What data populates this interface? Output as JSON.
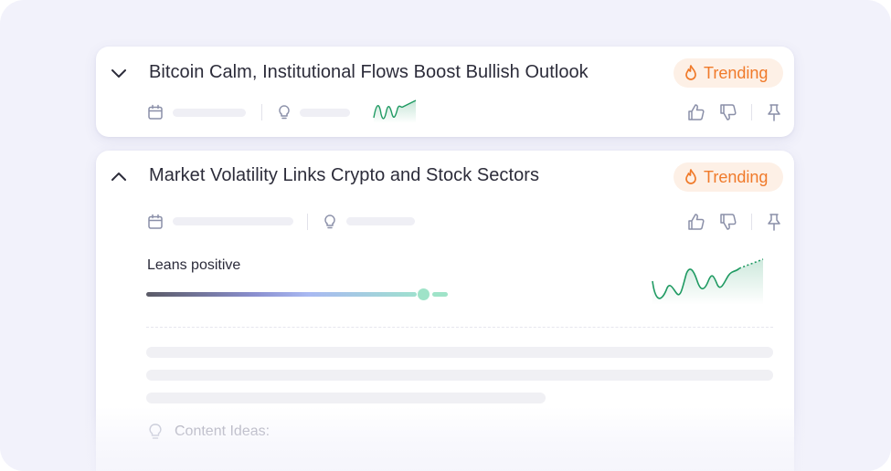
{
  "cards": [
    {
      "title": "Bitcoin Calm, Institutional Flows Boost Bullish Outlook",
      "badge": "Trending",
      "expanded": false,
      "chevron_icon": "chevron-down-icon"
    },
    {
      "title": "Market Volatility Links Crypto and Stock Sectors",
      "badge": "Trending",
      "expanded": true,
      "chevron_icon": "chevron-up-icon",
      "sentiment_label": "Leans positive",
      "sentiment_value": 0.94,
      "content_ideas_label": "Content Ideas:"
    }
  ],
  "icons": {
    "calendar": "calendar-icon",
    "idea": "lightbulb-icon",
    "like": "thumbs-up-icon",
    "dislike": "thumbs-down-icon",
    "pin": "pin-icon",
    "trend": "fire-icon"
  },
  "colors": {
    "badge_text": "#f07a2a",
    "badge_bg": "#fdf0e6",
    "sparkline": "#1f9a62",
    "sentiment_end": "#9fe3c8",
    "icon": "#8a8fa8"
  }
}
